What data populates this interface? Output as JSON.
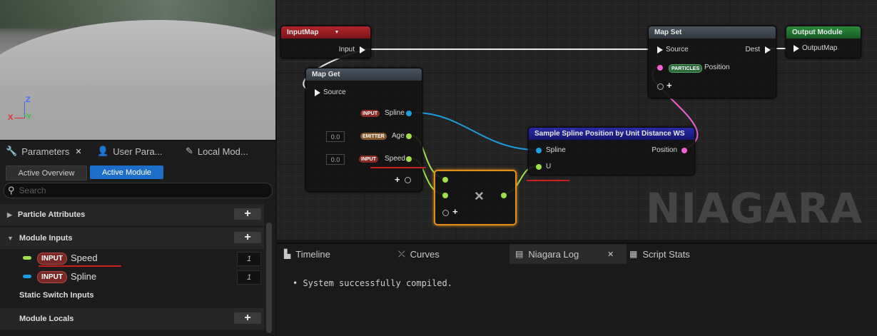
{
  "viewport": {
    "axis_z": "Z",
    "axis_x": "X",
    "axis_y": "Y"
  },
  "left_panel": {
    "tabs": [
      {
        "label": "Parameters",
        "icon": "wrench-icon",
        "close": "✕"
      },
      {
        "label": "User Para...",
        "icon": "person-icon"
      },
      {
        "label": "Local Mod...",
        "icon": "edit-icon"
      }
    ],
    "mode_buttons": [
      "Active Overview",
      "Active Module"
    ],
    "search_placeholder": "Search",
    "sections": {
      "particle_attributes": "Particle Attributes",
      "module_inputs": "Module Inputs",
      "static_switch_inputs": "Static Switch Inputs",
      "module_locals": "Module Locals"
    },
    "inputs": [
      {
        "badge": "INPUT",
        "name": "Speed",
        "value": "1",
        "color": "#9ee04a"
      },
      {
        "badge": "INPUT",
        "name": "Spline",
        "value": "1",
        "color": "#1aa0e0"
      }
    ],
    "plus": "+"
  },
  "graph": {
    "input_map": {
      "title": "InputMap",
      "pin": "Input"
    },
    "map_get": {
      "title": "Map Get",
      "source": "Source",
      "rows": [
        {
          "badge": "INPUT",
          "label": "Spline"
        },
        {
          "badge": "EMITTER",
          "label": "Age",
          "value": "0.0"
        },
        {
          "badge": "INPUT",
          "label": "Speed",
          "value": "0.0"
        }
      ]
    },
    "multiply": {
      "symbol": "×"
    },
    "sample_spline": {
      "title": "Sample Spline Position by Unit Distance WS",
      "in_spline": "Spline",
      "in_u": "U",
      "out": "Position"
    },
    "map_set": {
      "title": "Map Set",
      "source": "Source",
      "dest": "Dest",
      "badge": "PARTICLES",
      "pos": "Position"
    },
    "output_module": {
      "title": "Output Module",
      "pin": "OutputMap"
    },
    "watermark": "NIAGARA"
  },
  "log_panel": {
    "tabs": [
      {
        "label": "Timeline",
        "icon": "timeline-icon"
      },
      {
        "label": "Curves",
        "icon": "curves-icon"
      },
      {
        "label": "Niagara Log",
        "icon": "log-icon",
        "close": "✕"
      },
      {
        "label": "Script Stats",
        "icon": "stats-icon"
      }
    ],
    "message": "• System successfully compiled."
  },
  "colors": {
    "input_badge": "#7a2a26",
    "active_button": "#1c6ec8",
    "spline_pin": "#1aa0e0",
    "float_pin": "#9ee04a",
    "position_pin": "#f060d0"
  }
}
